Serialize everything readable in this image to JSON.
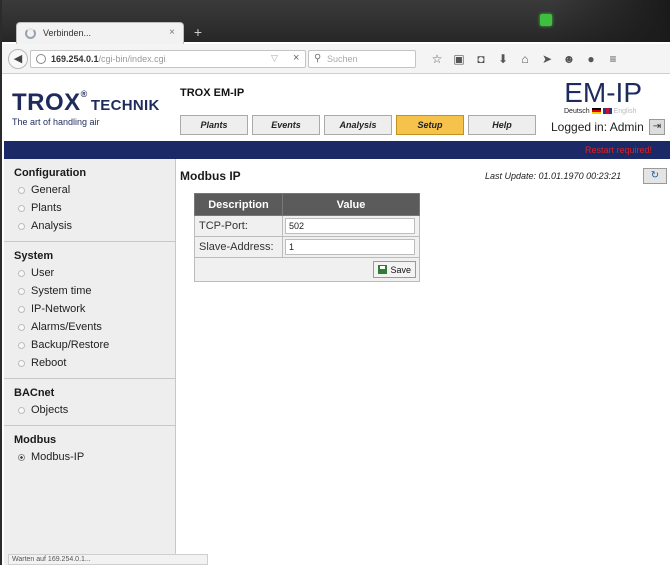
{
  "browser": {
    "tab_title": "Verbinden...",
    "tab_close": "×",
    "new_tab": "+",
    "url_host": "169.254.0.1",
    "url_path": "/cgi-bin/index.cgi",
    "url_dropdown": "▽",
    "url_clear": "×",
    "search_placeholder": "Suchen",
    "toolbar_icons": [
      "star-icon",
      "clipboard-icon",
      "pocket-icon",
      "download-icon",
      "home-icon",
      "send-icon",
      "smiley-icon",
      "chat-icon",
      "menu-icon"
    ],
    "status": "Warten auf 169.254.0.1..."
  },
  "header": {
    "logo_main": "TROX",
    "logo_reg": "®",
    "logo_tech": "TECHNIK",
    "logo_slogan": "The art of handling air",
    "app_title": "TROX EM-IP",
    "product": "EM-IP",
    "lang_de": "Deutsch",
    "lang_en": "English",
    "logged_in": "Logged in: Admin"
  },
  "nav": {
    "tabs": [
      {
        "label": "Plants",
        "active": false
      },
      {
        "label": "Events",
        "active": false
      },
      {
        "label": "Analysis",
        "active": false
      },
      {
        "label": "Setup",
        "active": true
      },
      {
        "label": "Help",
        "active": false
      }
    ]
  },
  "notice": "Restart required!",
  "sidebar": {
    "sections": [
      {
        "heading": "Configuration",
        "items": [
          "General",
          "Plants",
          "Analysis"
        ]
      },
      {
        "heading": "System",
        "items": [
          "User",
          "System time",
          "IP-Network",
          "Alarms/Events",
          "Backup/Restore",
          "Reboot"
        ]
      },
      {
        "heading": "BACnet",
        "items": [
          "Objects"
        ]
      },
      {
        "heading": "Modbus",
        "items": [
          "Modbus-IP"
        ]
      }
    ],
    "selected": "Modbus-IP"
  },
  "content": {
    "title": "Modbus IP",
    "last_update": "Last Update: 01.01.1970 00:23:21",
    "table": {
      "headers": [
        "Description",
        "Value"
      ],
      "rows": [
        {
          "label": "TCP-Port:",
          "value": "502"
        },
        {
          "label": "Slave-Address:",
          "value": "1"
        }
      ],
      "save_label": "Save"
    }
  },
  "colors": {
    "brand_navy": "#1e2b5c",
    "active_tab": "#f5c24b",
    "bluebar": "#1b2a66",
    "alert": "#e02020"
  }
}
